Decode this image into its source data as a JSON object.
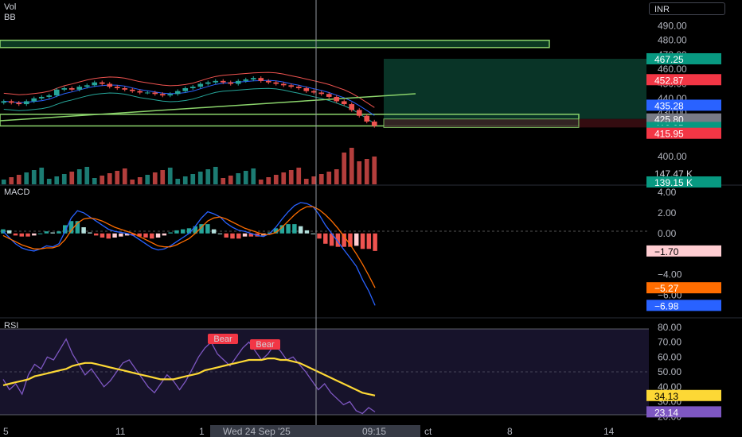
{
  "header": {
    "vol_label": "Vol",
    "bb_label": "BB",
    "currency": "INR"
  },
  "colors": {
    "up": "#26a69a",
    "down": "#ef5350",
    "bb_upper": "#ef5350",
    "bb_basis": "#2962ff",
    "bb_lower": "#26a69a",
    "trend": "#8bd36b",
    "zone_border": "#8bd36b",
    "macd": "#2962ff",
    "signal": "#ff6d00",
    "rsi": "#7e57c2",
    "rsi_ma": "#fdd835",
    "bear": "#f23645",
    "zone_fill": "#0a3d2e",
    "loss_fill": "#3a0d12"
  },
  "chart_data": [
    {
      "type": "candlestick",
      "title": "",
      "axis": {
        "ticks": [
          "500.00",
          "490.00",
          "480.00",
          "470.00",
          "460.00",
          "450.00",
          "440.00",
          "430.00",
          "400.00"
        ],
        "ylim": [
          395,
          505
        ]
      },
      "price_badges": [
        {
          "value": "467.25",
          "kind": "green"
        },
        {
          "value": "452.87",
          "kind": "red"
        },
        {
          "value": "435.28",
          "kind": "blue"
        },
        {
          "value": "425.80",
          "kind": "gray"
        },
        {
          "value": "419.95",
          "kind": "green"
        },
        {
          "value": "417.69",
          "kind": "green"
        },
        {
          "value": "415.95",
          "kind": "red"
        }
      ],
      "close_path": [
        438,
        437,
        436,
        438,
        440,
        441,
        442,
        446,
        447,
        446,
        448,
        449,
        451,
        450,
        448,
        447,
        446,
        445,
        444,
        444,
        443,
        442,
        443,
        445,
        447,
        448,
        450,
        451,
        452,
        451,
        450,
        452,
        453,
        454,
        452,
        451,
        450,
        449,
        448,
        447,
        445,
        444,
        443,
        441,
        438,
        436,
        432,
        428,
        424,
        421
      ],
      "zones": [
        {
          "name": "supply-zone",
          "top": 480,
          "bottom": 475
        },
        {
          "name": "demand-zone",
          "top": 429,
          "bottom": 421
        }
      ],
      "position": {
        "target": 467.25,
        "entry": 425.8,
        "stop": 419.95
      }
    },
    {
      "type": "bar",
      "title": "Vol",
      "badges": [
        {
          "value": "147.47 K",
          "kind": "text"
        },
        {
          "value": "139.15 K",
          "kind": "green"
        }
      ]
    },
    {
      "type": "line",
      "title": "MACD",
      "axis": {
        "ticks": [
          "4.00",
          "2.00",
          "0.00",
          "-4.00",
          "-6.00"
        ],
        "ylim": [
          -7.8,
          4.3
        ]
      },
      "series": [
        {
          "name": "",
          "values": [
            0.2,
            -0.4,
            -1.0,
            -1.4,
            -1.6,
            -1.7,
            -1.5,
            -1.2,
            -1.3,
            -1.0,
            0.2,
            1.5,
            2.2,
            2.0,
            1.6,
            1.2,
            0.8,
            0.4,
            0.2,
            0.1,
            0.0,
            -0.2,
            -0.6,
            -1.0,
            -1.4,
            -1.6,
            -1.5,
            -1.2,
            -0.8,
            -0.4,
            0.0,
            0.7,
            1.5,
            2.1,
            1.9,
            1.6,
            1.0,
            0.6,
            0.3,
            0.2,
            0.0,
            -0.2,
            -0.3,
            0.0,
            0.6,
            1.4,
            2.1,
            2.7,
            3.0,
            2.9,
            2.6,
            1.8,
            0.8,
            0.0,
            -0.8,
            -1.6,
            -2.4,
            -3.2,
            -4.5,
            -5.6,
            -6.98
          ]
        },
        {
          "name": "",
          "values": [
            -0.2,
            -0.5,
            -0.8,
            -1.1,
            -1.3,
            -1.5,
            -1.5,
            -1.4,
            -1.4,
            -1.2,
            -0.6,
            0.3,
            1.0,
            1.4,
            1.5,
            1.4,
            1.2,
            0.9,
            0.6,
            0.4,
            0.2,
            0.0,
            -0.3,
            -0.6,
            -0.9,
            -1.2,
            -1.3,
            -1.3,
            -1.1,
            -0.8,
            -0.5,
            0.0,
            0.6,
            1.2,
            1.5,
            1.6,
            1.4,
            1.1,
            0.8,
            0.5,
            0.3,
            0.1,
            -0.1,
            -0.1,
            0.1,
            0.6,
            1.2,
            1.8,
            2.3,
            2.6,
            2.6,
            2.3,
            1.8,
            1.2,
            0.5,
            -0.3,
            -1.1,
            -2.0,
            -3.0,
            -4.1,
            -5.27
          ]
        }
      ],
      "histogram": [
        0.4,
        0.3,
        -0.2,
        -0.3,
        -0.3,
        -0.2,
        0.0,
        0.2,
        0.1,
        0.2,
        0.8,
        1.2,
        1.2,
        0.6,
        0.1,
        -0.2,
        -0.4,
        -0.5,
        -0.4,
        -0.3,
        -0.2,
        -0.2,
        -0.3,
        -0.4,
        -0.5,
        -0.4,
        -0.2,
        0.1,
        0.3,
        0.4,
        0.5,
        0.7,
        0.9,
        0.9,
        0.4,
        0.0,
        -0.4,
        -0.5,
        -0.5,
        -0.3,
        -0.3,
        -0.3,
        -0.2,
        0.1,
        0.5,
        0.8,
        0.9,
        0.9,
        0.7,
        0.3,
        0.0,
        -0.5,
        -1.0,
        -1.2,
        -1.3,
        -1.3,
        -1.3,
        -1.2,
        -1.5,
        -1.5,
        -1.7
      ],
      "badges": [
        {
          "value": "−1.70",
          "kind": "pink"
        },
        {
          "value": "−5.27",
          "kind": "orange"
        },
        {
          "value": "−6.98",
          "kind": "blue"
        }
      ]
    },
    {
      "type": "line",
      "title": "RSI",
      "axis": {
        "ticks": [
          "80.00",
          "70.00",
          "60.00",
          "50.00",
          "40.00",
          "30.00",
          "20.00"
        ],
        "ylim": [
          18,
          82
        ]
      },
      "series": [
        {
          "name": "",
          "values": [
            45,
            38,
            42,
            35,
            48,
            55,
            52,
            60,
            58,
            65,
            72,
            62,
            55,
            48,
            52,
            46,
            40,
            44,
            50,
            56,
            58,
            52,
            46,
            40,
            36,
            42,
            48,
            44,
            38,
            44,
            52,
            60,
            66,
            70,
            62,
            58,
            54,
            60,
            66,
            70,
            64,
            58,
            62,
            68,
            64,
            58,
            60,
            55,
            50,
            44,
            38,
            42,
            36,
            32,
            28,
            30,
            24,
            22,
            26,
            23.14
          ]
        },
        {
          "name": "",
          "values": [
            41,
            42,
            43,
            44,
            45,
            47,
            48,
            49,
            50,
            51,
            52,
            54,
            55,
            56,
            56,
            55,
            54,
            53,
            52,
            51,
            50,
            49,
            48,
            47,
            46,
            45,
            45,
            45,
            46,
            47,
            48,
            49,
            51,
            52,
            53,
            54,
            55,
            56,
            57,
            58,
            58,
            58,
            59,
            59,
            58,
            58,
            57,
            56,
            54,
            52,
            50,
            48,
            46,
            44,
            42,
            40,
            38,
            36,
            35,
            34.13
          ]
        }
      ],
      "annotations": [
        "Bear",
        "Bear"
      ],
      "badges": [
        {
          "value": "34.13",
          "kind": "yellow"
        },
        {
          "value": "23.14",
          "kind": "purple"
        }
      ]
    }
  ],
  "time_axis": {
    "labels": [
      "5",
      "11",
      "1",
      "ct",
      "8",
      "14"
    ],
    "crosshair_label": "Wed 24 Sep '25",
    "crosshair_time": "09:15"
  }
}
